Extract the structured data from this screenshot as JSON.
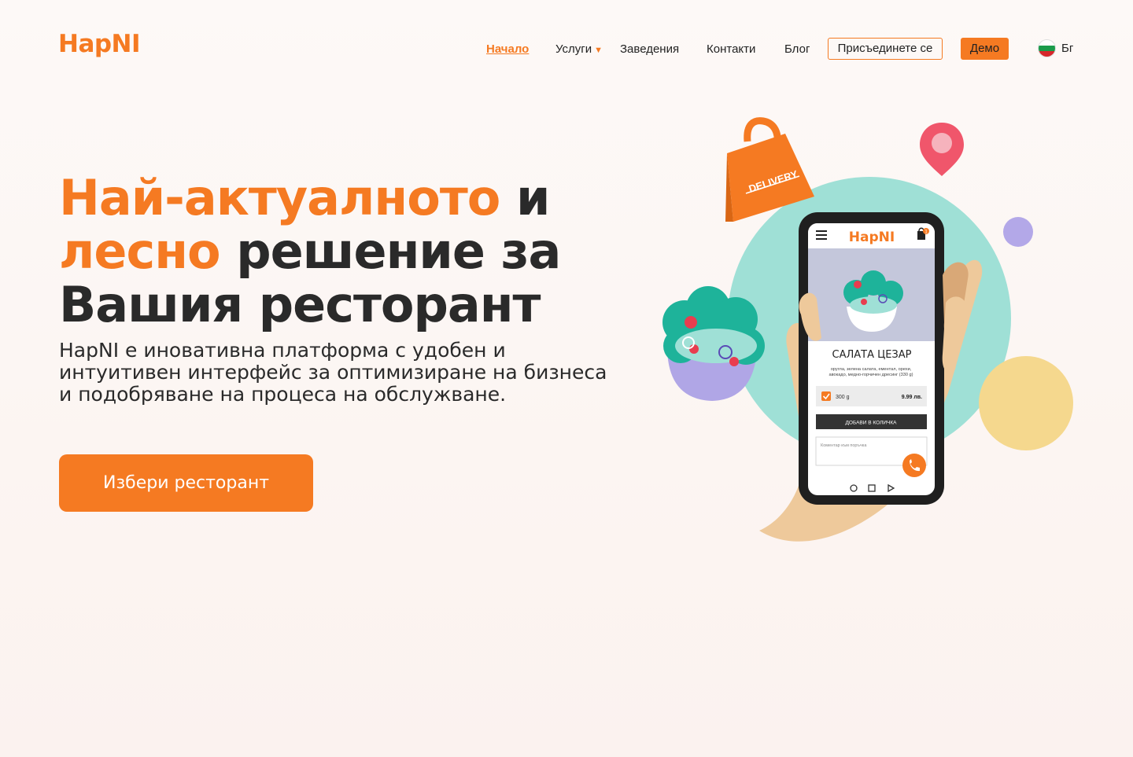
{
  "brand": {
    "logo_text": "HapNI",
    "accent": "#f57a22"
  },
  "nav": {
    "items": [
      {
        "label": "Начало",
        "active": true
      },
      {
        "label": "Услуги",
        "has_dropdown": true
      },
      {
        "label": "Заведения"
      },
      {
        "label": "Контакти"
      },
      {
        "label": "Блог"
      }
    ],
    "join_label": "Присъединете се",
    "demo_label": "Демо",
    "language_label": "Бг"
  },
  "hero": {
    "headline": {
      "part1_orange": "Най-актуалното",
      "part2_dark": " и",
      "part3_orange": "лесно",
      "part4_dark": " решение за",
      "part5_dark": "Вашия ресторант"
    },
    "subtitle": "HapNI е иновативна платформа с удобен и интуитивен интерфейс за оптимизиране на бизнеса и подобряване на процеса на обслужване.",
    "cta_label": "Избери ресторант"
  },
  "illustration": {
    "bag_text": "DELIVERY",
    "phone": {
      "logo": "HapNI",
      "cart_count": "1",
      "dish_title": "САЛАТА ЦЕЗАР",
      "dish_desc_line1": "оруглa, зелена салата, ементал, орехи,",
      "dish_desc_line2": "авокадо, медно-горчичен дресинг (330 g)",
      "option_weight": "300 g",
      "option_price": "9.99 лв.",
      "add_button": "ДОБАВИ В КОЛИЧКА",
      "comment_placeholder": "Коментар към поръчка"
    }
  }
}
